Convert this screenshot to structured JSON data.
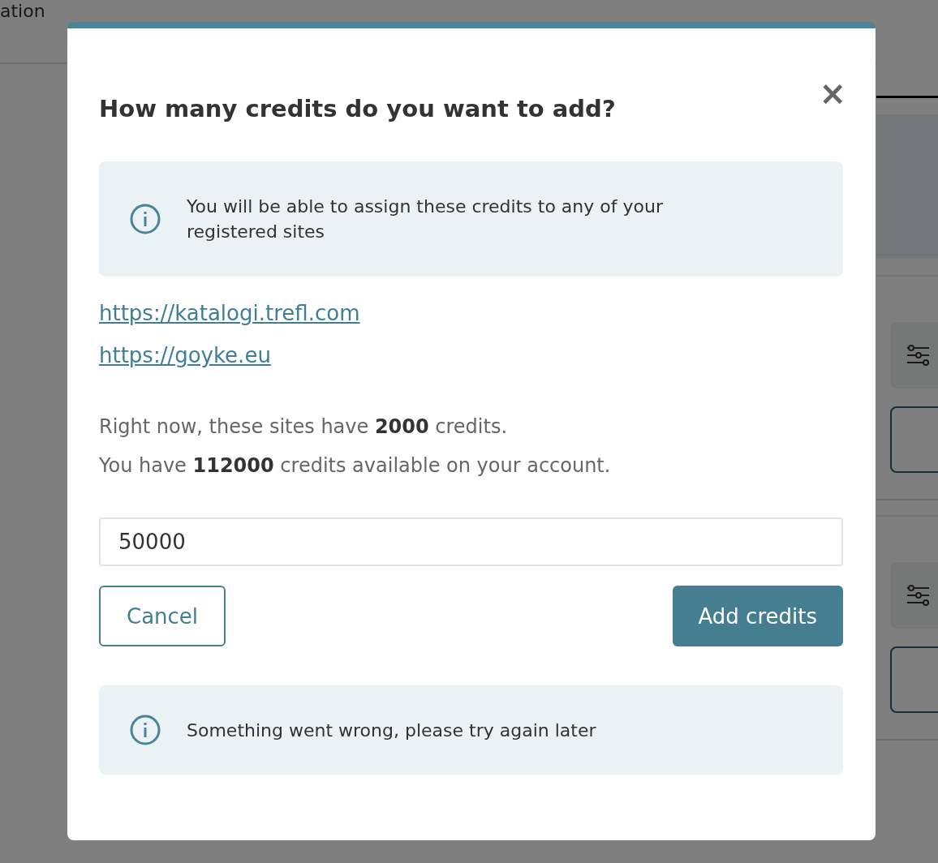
{
  "background": {
    "header_text": "ation"
  },
  "dialog": {
    "title": "How many credits do you want to add?",
    "close": "×",
    "info": "You will be able to assign these credits to any of your registered sites",
    "sites": [
      "https://katalogi.trefl.com",
      "https://goyke.eu"
    ],
    "summary": [
      "Right now, these sites have **2000** credits.",
      "You have **112000** credits available on your account."
    ],
    "amount": {
      "value": "50000"
    },
    "buttons": [
      {
        "label": "Cancel",
        "kind": "secondary"
      },
      {
        "label": "Add credits",
        "kind": "primary"
      }
    ],
    "error": "Something went wrong, please try again later"
  }
}
